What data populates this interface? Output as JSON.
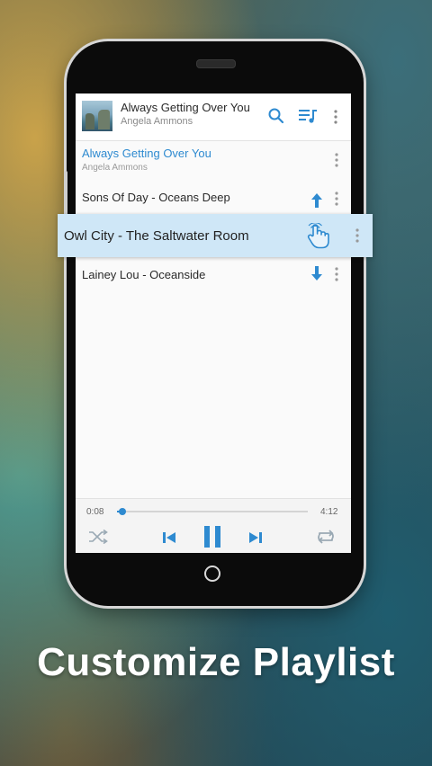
{
  "header": {
    "title": "Always Getting Over You",
    "artist": "Angela Ammons",
    "icons": [
      "search-icon",
      "playlist-icon",
      "more-vert-icon"
    ],
    "accent_color": "#2e8ad0"
  },
  "playlist": [
    {
      "title": "Always Getting Over You",
      "artist": "Angela Ammons",
      "state": "now-playing"
    },
    {
      "title": "Sons Of Day - Oceans Deep",
      "state": "move-up"
    },
    {
      "title": "Owl City - The Saltwater Room",
      "state": "dragging"
    },
    {
      "title": "Lainey Lou - Oceanside",
      "state": "move-down"
    }
  ],
  "player": {
    "elapsed": "0:08",
    "duration": "4:12",
    "progress": 0.03,
    "controls": [
      "shuffle-icon",
      "previous-icon",
      "pause-icon",
      "next-icon",
      "repeat-icon"
    ]
  },
  "caption": "Customize Playlist"
}
